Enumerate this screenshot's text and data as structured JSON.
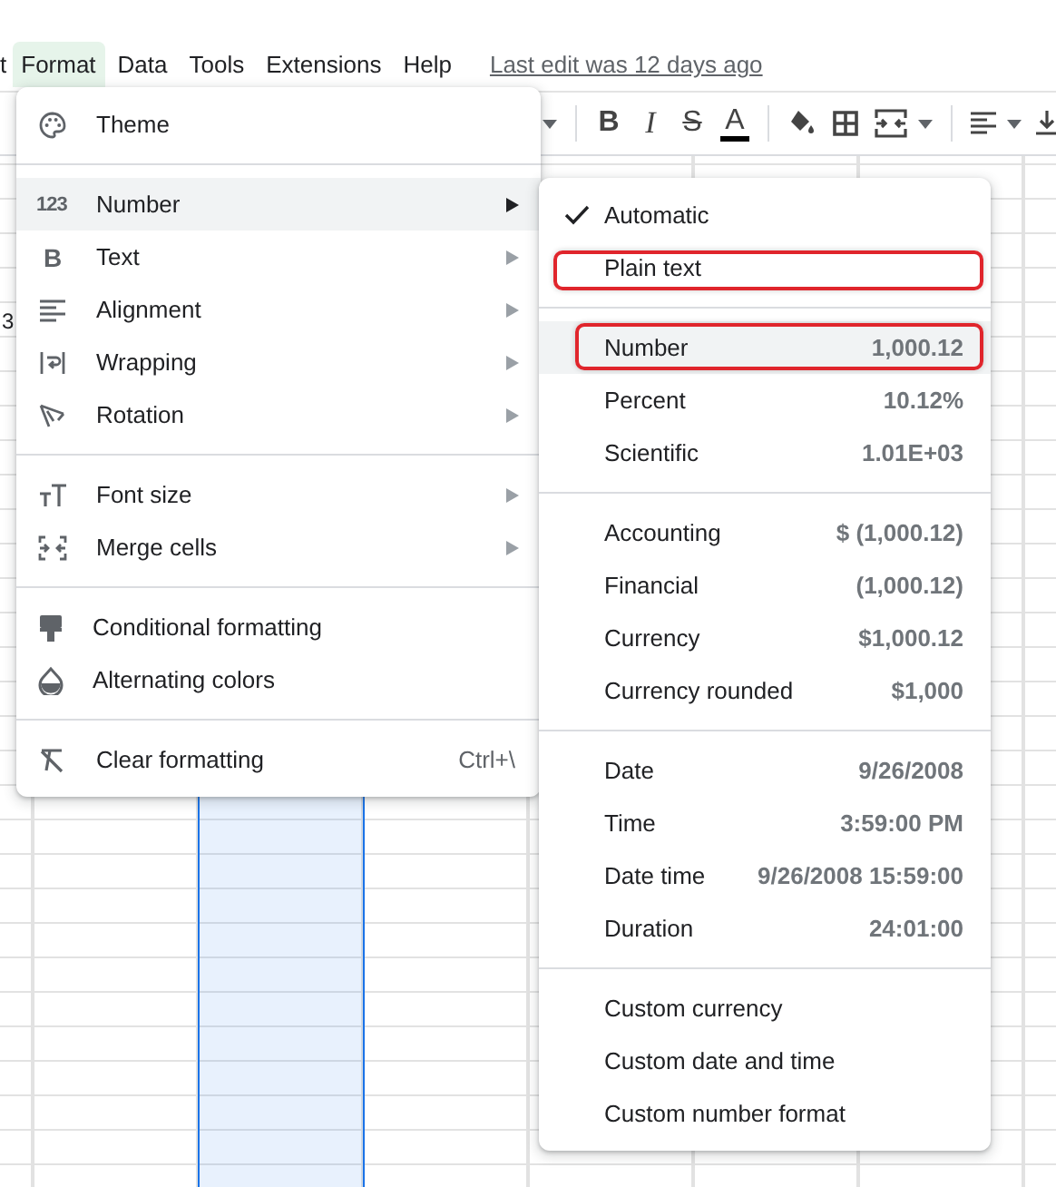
{
  "menu_bar": {
    "items": [
      {
        "label": "t",
        "selected": false
      },
      {
        "label": "Format",
        "selected": true
      },
      {
        "label": "Data",
        "selected": false
      },
      {
        "label": "Tools",
        "selected": false
      },
      {
        "label": "Extensions",
        "selected": false
      },
      {
        "label": "Help",
        "selected": false
      }
    ],
    "last_edit": "Last edit was 12 days ago"
  },
  "toolbar": [
    {
      "kind": "caret"
    },
    {
      "kind": "divider"
    },
    {
      "kind": "bold",
      "label": "B"
    },
    {
      "kind": "italic",
      "label": "I"
    },
    {
      "kind": "strikethrough",
      "label": "S"
    },
    {
      "kind": "text_color",
      "label": "A"
    },
    {
      "kind": "divider"
    },
    {
      "kind": "fill_color"
    },
    {
      "kind": "borders"
    },
    {
      "kind": "merge"
    },
    {
      "kind": "caret"
    },
    {
      "kind": "divider"
    },
    {
      "kind": "align"
    },
    {
      "kind": "caret"
    },
    {
      "kind": "valign"
    }
  ],
  "sheet": {
    "cell_text": "3"
  },
  "format_menu": {
    "groups": [
      [
        {
          "label": "Theme",
          "has_submenu": false,
          "hovered": false
        }
      ],
      [
        {
          "label": "Number",
          "icon_glyph": "123",
          "has_submenu": true,
          "hovered": true
        },
        {
          "label": "Text",
          "icon_glyph": "B",
          "has_submenu": true,
          "hovered": false
        },
        {
          "label": "Alignment",
          "has_submenu": true,
          "hovered": false
        },
        {
          "label": "Wrapping",
          "has_submenu": true,
          "hovered": false
        },
        {
          "label": "Rotation",
          "has_submenu": true,
          "hovered": false
        }
      ],
      [
        {
          "label": "Font size",
          "has_submenu": true,
          "hovered": false
        },
        {
          "label": "Merge cells",
          "has_submenu": true,
          "hovered": false
        }
      ],
      [
        {
          "label": "Conditional formatting",
          "has_submenu": false,
          "hovered": false
        },
        {
          "label": "Alternating colors",
          "has_submenu": false,
          "hovered": false
        }
      ],
      [
        {
          "label": "Clear formatting",
          "shortcut": "Ctrl+\\",
          "has_submenu": false,
          "hovered": false
        }
      ]
    ]
  },
  "number_submenu": {
    "groups": [
      [
        {
          "label": "Automatic",
          "checked": true,
          "hovered": false,
          "outlined": false
        },
        {
          "label": "Plain text",
          "checked": false,
          "hovered": false,
          "outlined": true
        }
      ],
      [
        {
          "label": "Number",
          "example": "1,000.12",
          "checked": false,
          "hovered": true,
          "outlined": true
        },
        {
          "label": "Percent",
          "example": "10.12%",
          "checked": false,
          "hovered": false,
          "outlined": false
        },
        {
          "label": "Scientific",
          "example": "1.01E+03",
          "checked": false,
          "hovered": false,
          "outlined": false
        }
      ],
      [
        {
          "label": "Accounting",
          "example": "$ (1,000.12)",
          "checked": false,
          "hovered": false,
          "outlined": false
        },
        {
          "label": "Financial",
          "example": "(1,000.12)",
          "checked": false,
          "hovered": false,
          "outlined": false
        },
        {
          "label": "Currency",
          "example": "$1,000.12",
          "checked": false,
          "hovered": false,
          "outlined": false
        },
        {
          "label": "Currency rounded",
          "example": "$1,000",
          "checked": false,
          "hovered": false,
          "outlined": false
        }
      ],
      [
        {
          "label": "Date",
          "example": "9/26/2008",
          "checked": false,
          "hovered": false,
          "outlined": false
        },
        {
          "label": "Time",
          "example": "3:59:00 PM",
          "checked": false,
          "hovered": false,
          "outlined": false
        },
        {
          "label": "Date time",
          "example": "9/26/2008 15:59:00",
          "checked": false,
          "hovered": false,
          "outlined": false
        },
        {
          "label": "Duration",
          "example": "24:01:00",
          "checked": false,
          "hovered": false,
          "outlined": false
        }
      ],
      [
        {
          "label": "Custom currency",
          "checked": false,
          "hovered": false,
          "outlined": false
        },
        {
          "label": "Custom date and time",
          "checked": false,
          "hovered": false,
          "outlined": false
        },
        {
          "label": "Custom number format",
          "checked": false,
          "hovered": false,
          "outlined": false
        }
      ]
    ]
  }
}
